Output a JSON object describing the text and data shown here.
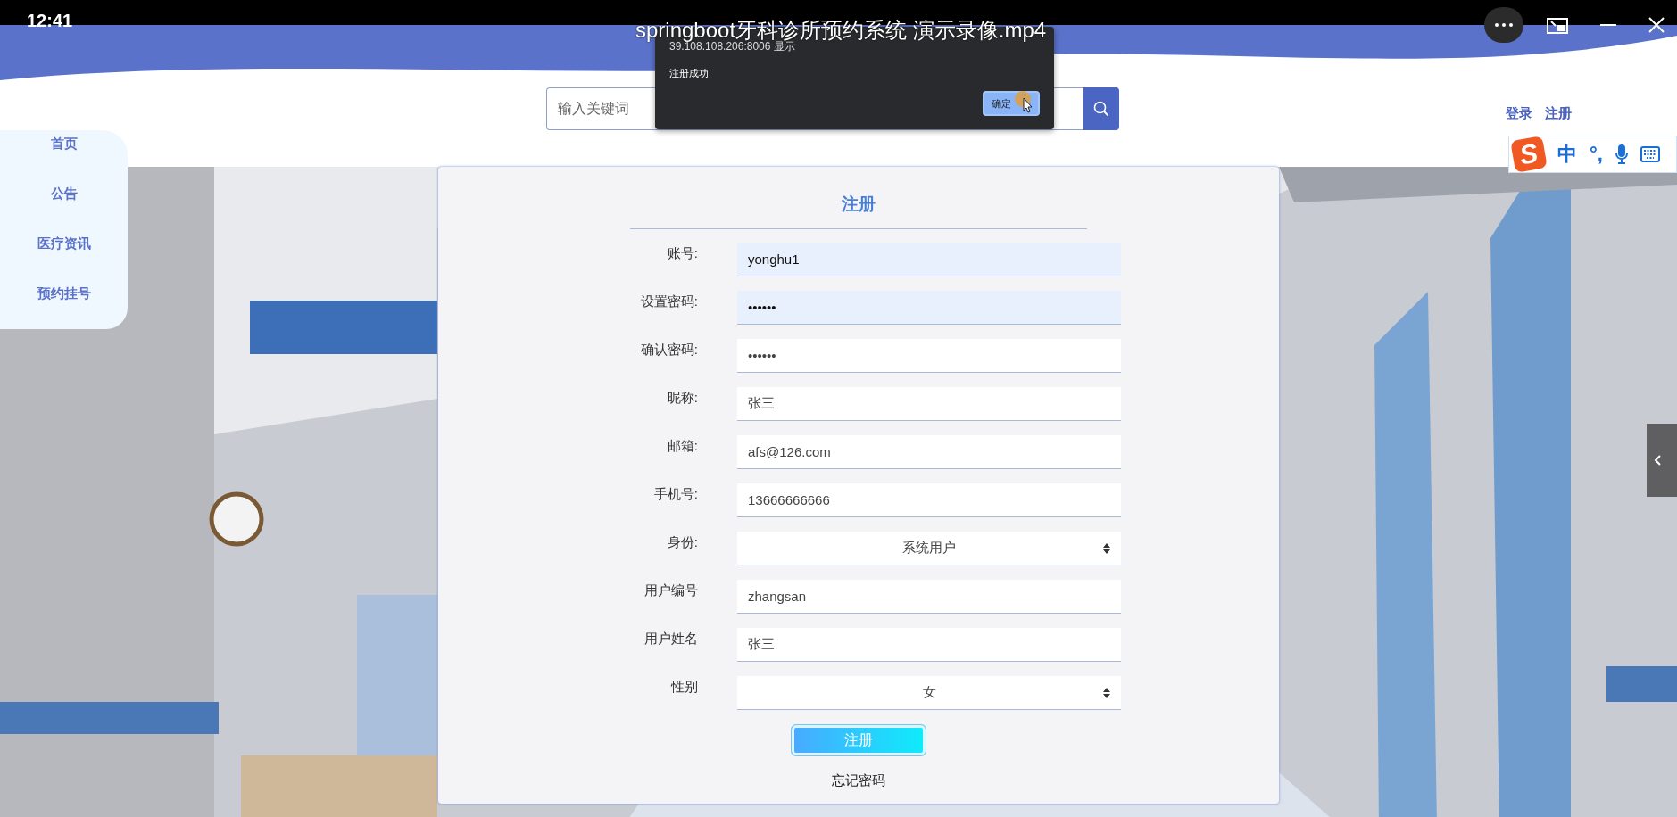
{
  "video_player": {
    "time": "12:41",
    "title": "springboot牙科诊所预约系统 演示录像.mp4"
  },
  "header": {
    "search": {
      "placeholder": "输入关键词"
    },
    "links": [
      {
        "label": "登录"
      },
      {
        "label": "注册"
      }
    ]
  },
  "sidebar": {
    "items": [
      {
        "label": "首页"
      },
      {
        "label": "公告"
      },
      {
        "label": "医疗资讯"
      },
      {
        "label": "预约挂号"
      }
    ]
  },
  "form": {
    "title": "注册",
    "fields": [
      {
        "label": "账号:",
        "kind": "input",
        "value": "yonghu1",
        "autofilled": true
      },
      {
        "label": "设置密码:",
        "kind": "input",
        "value": "••••••",
        "autofilled": true
      },
      {
        "label": "确认密码:",
        "kind": "input",
        "value": "••••••",
        "autofilled": false
      },
      {
        "label": "昵称:",
        "kind": "input",
        "value": "张三",
        "autofilled": false
      },
      {
        "label": "邮箱:",
        "kind": "input",
        "value": "afs@126.com",
        "autofilled": false
      },
      {
        "label": "手机号:",
        "kind": "input",
        "value": "13666666666",
        "autofilled": false
      },
      {
        "label": "身份:",
        "kind": "select",
        "value": "系统用户",
        "autofilled": false
      },
      {
        "label": "用户编号",
        "kind": "input",
        "value": "zhangsan",
        "autofilled": false
      },
      {
        "label": "用户姓名",
        "kind": "input",
        "value": "张三",
        "autofilled": false
      },
      {
        "label": "性别",
        "kind": "select",
        "value": "女",
        "autofilled": false
      }
    ],
    "submit": "注册",
    "forgot": "忘记密码"
  },
  "alert": {
    "origin": "39.108.108.206:8006 显示",
    "message": "注册成功!",
    "button": "确定"
  },
  "ime_toolbar": {
    "logo_text": "S",
    "mode": "中",
    "punctuation": "°,"
  }
}
